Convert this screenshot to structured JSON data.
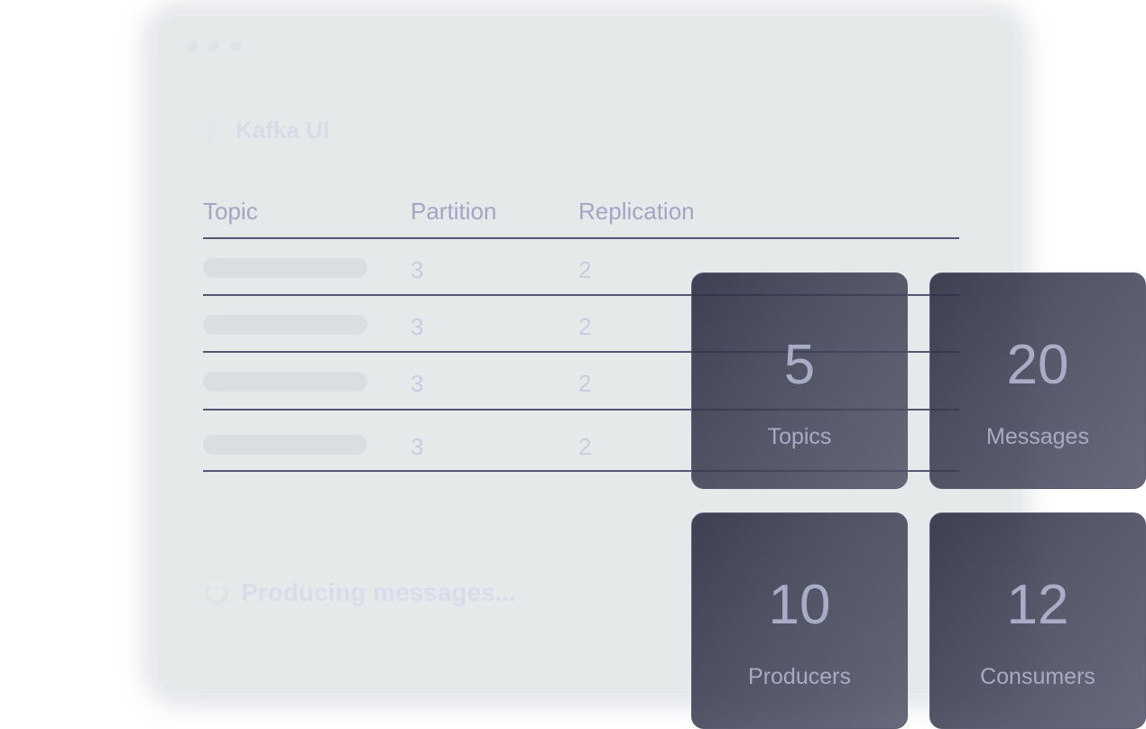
{
  "app": {
    "title": "Kafka UI"
  },
  "table": {
    "headers": [
      "Topic",
      "Partition",
      "Replication"
    ],
    "rows": [
      {
        "partition": "3",
        "replication": "2"
      },
      {
        "partition": "3",
        "replication": "2"
      },
      {
        "partition": "3",
        "replication": "2"
      },
      {
        "partition": "3",
        "replication": "2"
      }
    ]
  },
  "status": {
    "text": "Producing messages..."
  },
  "stats": {
    "topics": {
      "value": "5",
      "label": "Topics"
    },
    "messages": {
      "value": "20",
      "label": "Messages"
    },
    "producers": {
      "value": "10",
      "label": "Producers"
    },
    "consumers": {
      "value": "12",
      "label": "Consumers"
    }
  },
  "icons": {
    "brand": "kafka-logo-icon",
    "loading": "spinner-icon"
  },
  "colors": {
    "panel_bg": "#e6e9ea",
    "table_rule": "#54576f",
    "card_bg": "#383a4e",
    "card_text": "#a6a9c4"
  }
}
